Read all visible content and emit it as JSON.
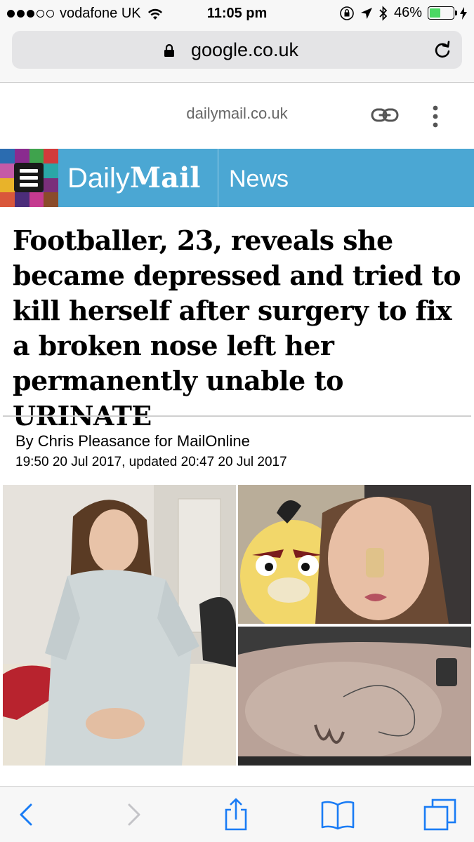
{
  "status_bar": {
    "carrier": "vodafone UK",
    "time": "11:05 pm",
    "battery_percent_label": "46%",
    "battery_level": 0.46,
    "signal_bars_filled": 3,
    "signal_bars_total": 5
  },
  "browser": {
    "url": "google.co.uk"
  },
  "amp_header": {
    "domain": "dailymail.co.uk"
  },
  "banner": {
    "logo_daily": "Daily",
    "logo_mail": "Mail",
    "section": "News",
    "brand_color": "#4ba7d3"
  },
  "article": {
    "headline": "Footballer, 23, reveals she became depressed and tried to kill herself after surgery to fix a broken nose left her permanently unable to URINATE",
    "byline": "By Chris Pleasance for MailOnline",
    "dateline": "19:50 20 Jul 2017, updated 20:47 20 Jul 2017"
  },
  "toolbar": {
    "icons": [
      "back-icon",
      "forward-icon",
      "share-icon",
      "bookmarks-icon",
      "tabs-icon"
    ],
    "accent": "#1a7cf5"
  }
}
